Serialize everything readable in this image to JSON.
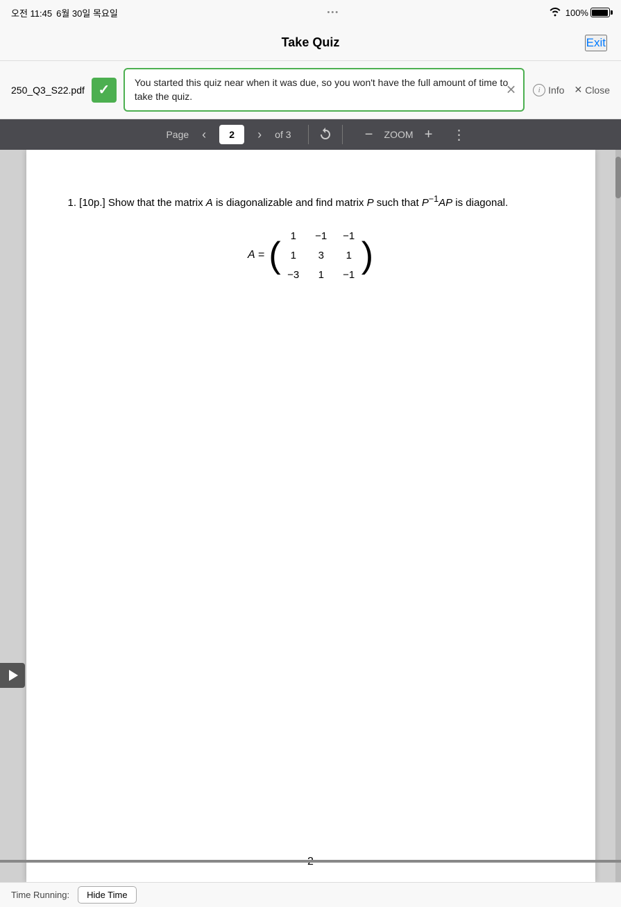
{
  "statusBar": {
    "time": "오전 11:45",
    "date": "6월 30일 목요일",
    "battery": "100%"
  },
  "navBar": {
    "title": "Take Quiz",
    "exitLabel": "Exit"
  },
  "toastBar": {
    "filename": "250_Q3_S22.pdf",
    "message": "You started this quiz near when it was due, so you won't have the full amount of time to take the quiz.",
    "infoLabel": "Info",
    "closeLabel": "Close"
  },
  "toolbar": {
    "pageLabel": "Page",
    "currentPage": "2",
    "totalPages": "of 3",
    "zoomLabel": "ZOOM"
  },
  "content": {
    "problemNumber": "1.",
    "problemText": "[10p.] Show that the matrix A is diagonalizable and find matrix P such that P⁻¹AP is diagonal.",
    "matrixLabel": "A =",
    "matrix": [
      [
        "1",
        "−1",
        "−1"
      ],
      [
        "1",
        "3",
        "1"
      ],
      [
        "−3",
        "1",
        "−1"
      ]
    ],
    "pageNumber": "2"
  },
  "bottomBar": {
    "timeRunningLabel": "Time Running:",
    "hideTimeLabel": "Hide Time"
  }
}
